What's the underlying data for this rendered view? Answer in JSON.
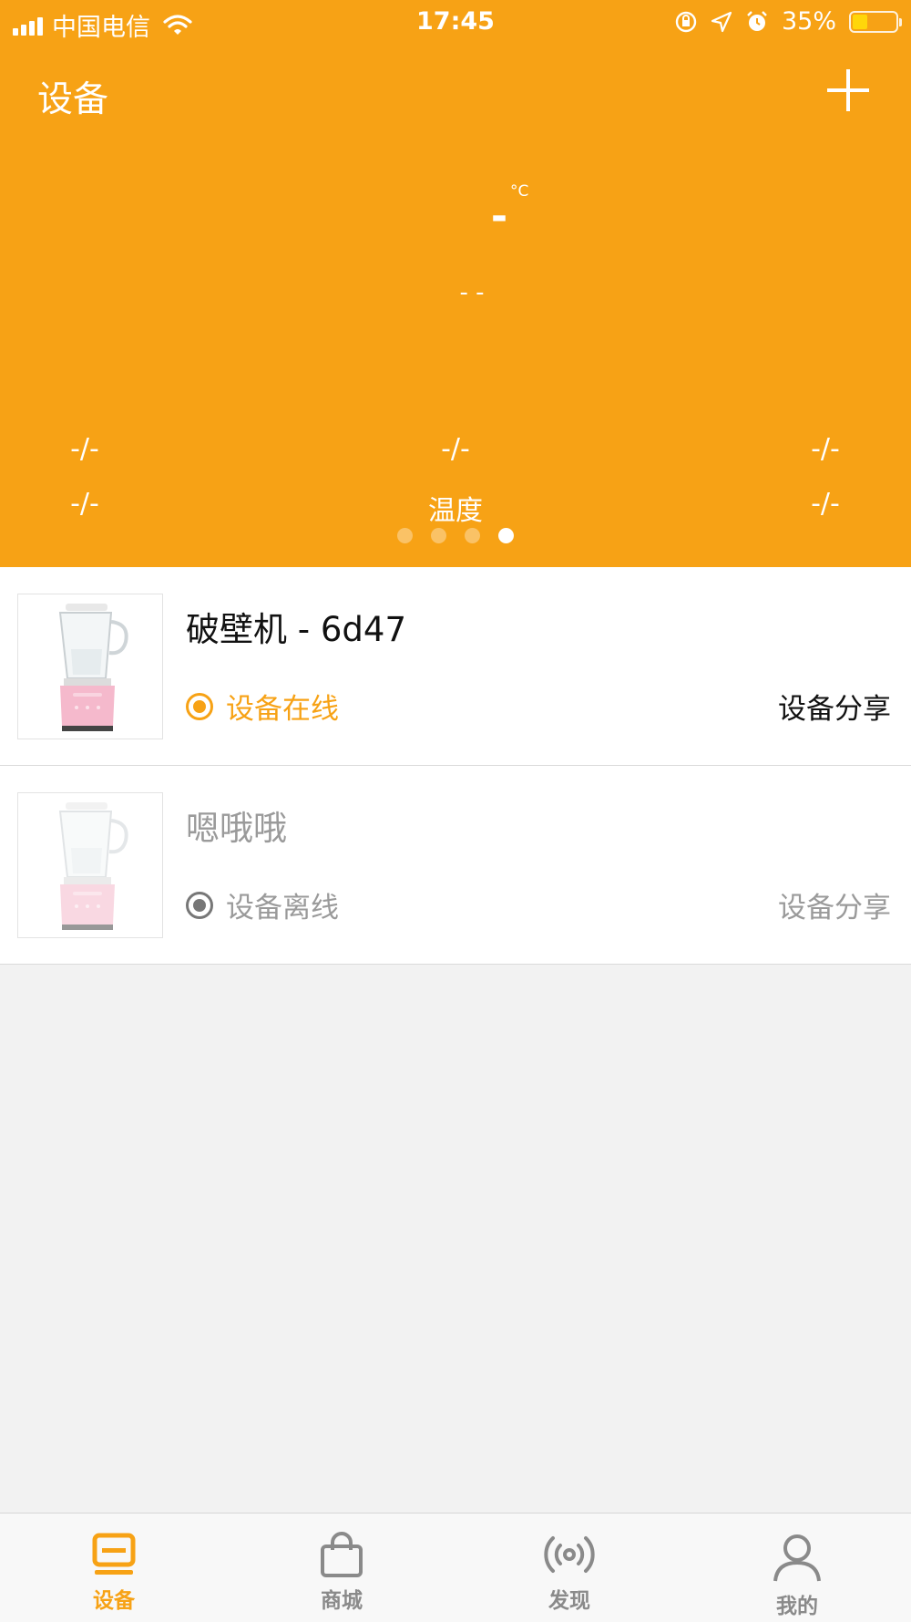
{
  "status_bar": {
    "carrier": "中国电信",
    "time": "17:45",
    "battery": "35%"
  },
  "header": {
    "title": "设备",
    "temp_unit": "°C",
    "temp_value": "-",
    "temp_sub": "- -",
    "stats": [
      {
        "top_left": "-/-",
        "top_center": "-/-",
        "top_right": "-/-"
      },
      {
        "bottom_left": "-/-",
        "bottom_center": "温度",
        "bottom_right": "-/-"
      }
    ],
    "page_count": 4,
    "active_page": 4,
    "accent_color": "#f7a215"
  },
  "devices": [
    {
      "name": "破壁机 - 6d47",
      "status": "设备在线",
      "share": "设备分享",
      "online": true
    },
    {
      "name": "嗯哦哦",
      "status": "设备离线",
      "share": "设备分享",
      "online": false
    }
  ],
  "tabbar": {
    "tabs": [
      {
        "label": "设备",
        "icon": "device-icon",
        "active": true
      },
      {
        "label": "商城",
        "icon": "shopping-bag-icon",
        "active": false
      },
      {
        "label": "发现",
        "icon": "broadcast-icon",
        "active": false
      },
      {
        "label": "我的",
        "icon": "user-icon",
        "active": false
      }
    ]
  }
}
